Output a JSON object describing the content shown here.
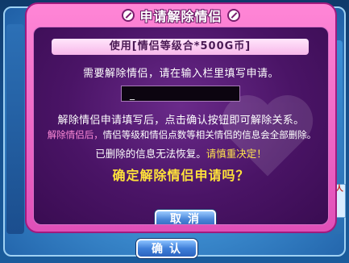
{
  "dialog": {
    "title": "申请解除情侣",
    "usage_text": "使用[情侣等级合*500G币]",
    "instruction": "需要解除情侣，请在输入栏里填写申请。",
    "input_value": "_",
    "desc_line1": "解除情侣申请填写后，点击确认按钮即可解除关系。",
    "desc_line2_prefix": "解除情侣后，",
    "desc_line2_rest": "情侣等级和情侣点数等相关情侣的信息会全部删除。",
    "desc_line3_prefix": "已删除的信息无法恢复。",
    "desc_line3_warn": "请慎重决定！",
    "question": "确定解除情侣申请吗？",
    "cancel_label": "取消"
  },
  "background": {
    "confirm_label": "确认",
    "side_badge": "人"
  },
  "colors": {
    "dialog_frame": "#e04fb8",
    "dialog_inner": "#4a1466",
    "accent_pink": "#ff8bd8",
    "warn_yellow": "#ffe23a",
    "button_blue": "#3f7fd9"
  }
}
